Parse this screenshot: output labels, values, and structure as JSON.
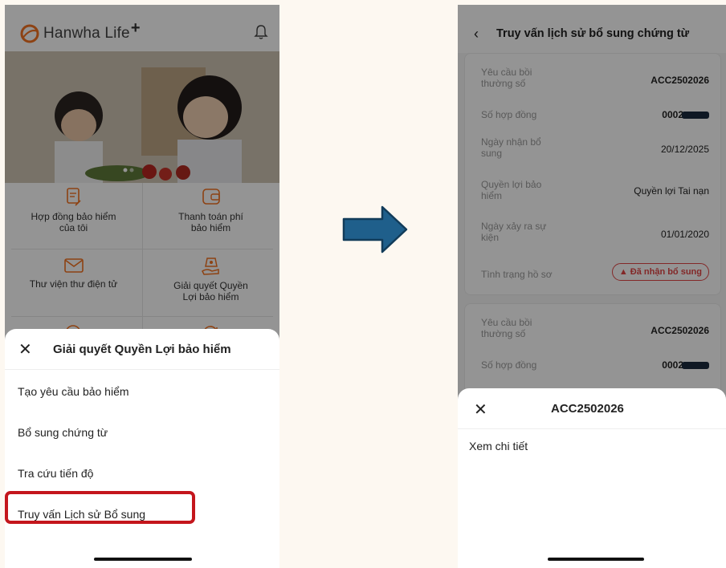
{
  "left": {
    "logo_text": "Hanwha Life",
    "logo_plus": "+",
    "menu_grid": [
      {
        "label_line1": "Hợp đồng bảo hiểm",
        "label_line2": "của tôi",
        "icon": "contract-icon"
      },
      {
        "label_line1": "Thanh toán phí",
        "label_line2": "bảo hiểm",
        "icon": "wallet-icon"
      },
      {
        "label_line1": "Thư viện thư điện tử",
        "label_line2": "",
        "icon": "mail-icon"
      },
      {
        "label_line1": "Giải quyết Quyền",
        "label_line2": "Lợi bảo hiểm",
        "icon": "claim-hand-icon"
      }
    ],
    "sheet": {
      "title": "Giải quyết Quyền Lợi bảo hiểm",
      "items": [
        "Tạo yêu cầu bảo hiểm",
        "Bổ sung chứng từ",
        "Tra cứu tiến độ",
        "Truy vấn Lịch sử Bổ sung"
      ],
      "highlight_color": "#c4161c"
    }
  },
  "right": {
    "title": "Truy vấn lịch sử bổ sung chứng từ",
    "card1": {
      "claim_label": "Yêu cầu bồi thường số",
      "claim_value": "ACC2502026",
      "contract_label": "Số hợp đồng",
      "contract_value": "0002",
      "received_label": "Ngày nhận bổ sung",
      "received_value": "20/12/2025",
      "benefit_label": "Quyền lợi bảo hiểm",
      "benefit_value": "Quyền lợi Tai nạn",
      "incident_label": "Ngày xảy ra sự kiện",
      "incident_value": "01/01/2020",
      "status_label": "Tình trạng hồ sơ",
      "status_value": "Đã nhận bổ sung",
      "status_icon": "▲"
    },
    "card2": {
      "claim_label": "Yêu cầu bồi thường số",
      "claim_value": "ACC2502026",
      "contract_label": "Số hợp đồng",
      "contract_value": "0002"
    },
    "sheet": {
      "title": "ACC2502026",
      "item": "Xem chi tiết"
    }
  },
  "colors": {
    "brand_orange": "#f37321",
    "status_red": "#e24545",
    "arrow_fill": "#1f5f8b"
  }
}
